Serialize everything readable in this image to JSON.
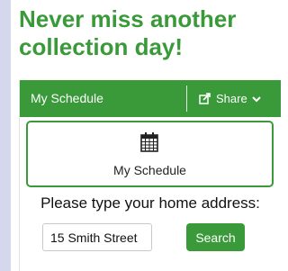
{
  "headline": "Never miss another collection day!",
  "widget": {
    "bar_title": "My Schedule",
    "share_label": "Share",
    "card_label": "My Schedule",
    "prompt": "Please type your home address:",
    "address_value": "15 Smith Street",
    "search_label": "Search"
  },
  "colors": {
    "brand_green": "#3a9a3a",
    "side_stripe": "#d5d8ec"
  },
  "icons": [
    "share-icon",
    "chevron-down-icon",
    "calendar-icon"
  ]
}
